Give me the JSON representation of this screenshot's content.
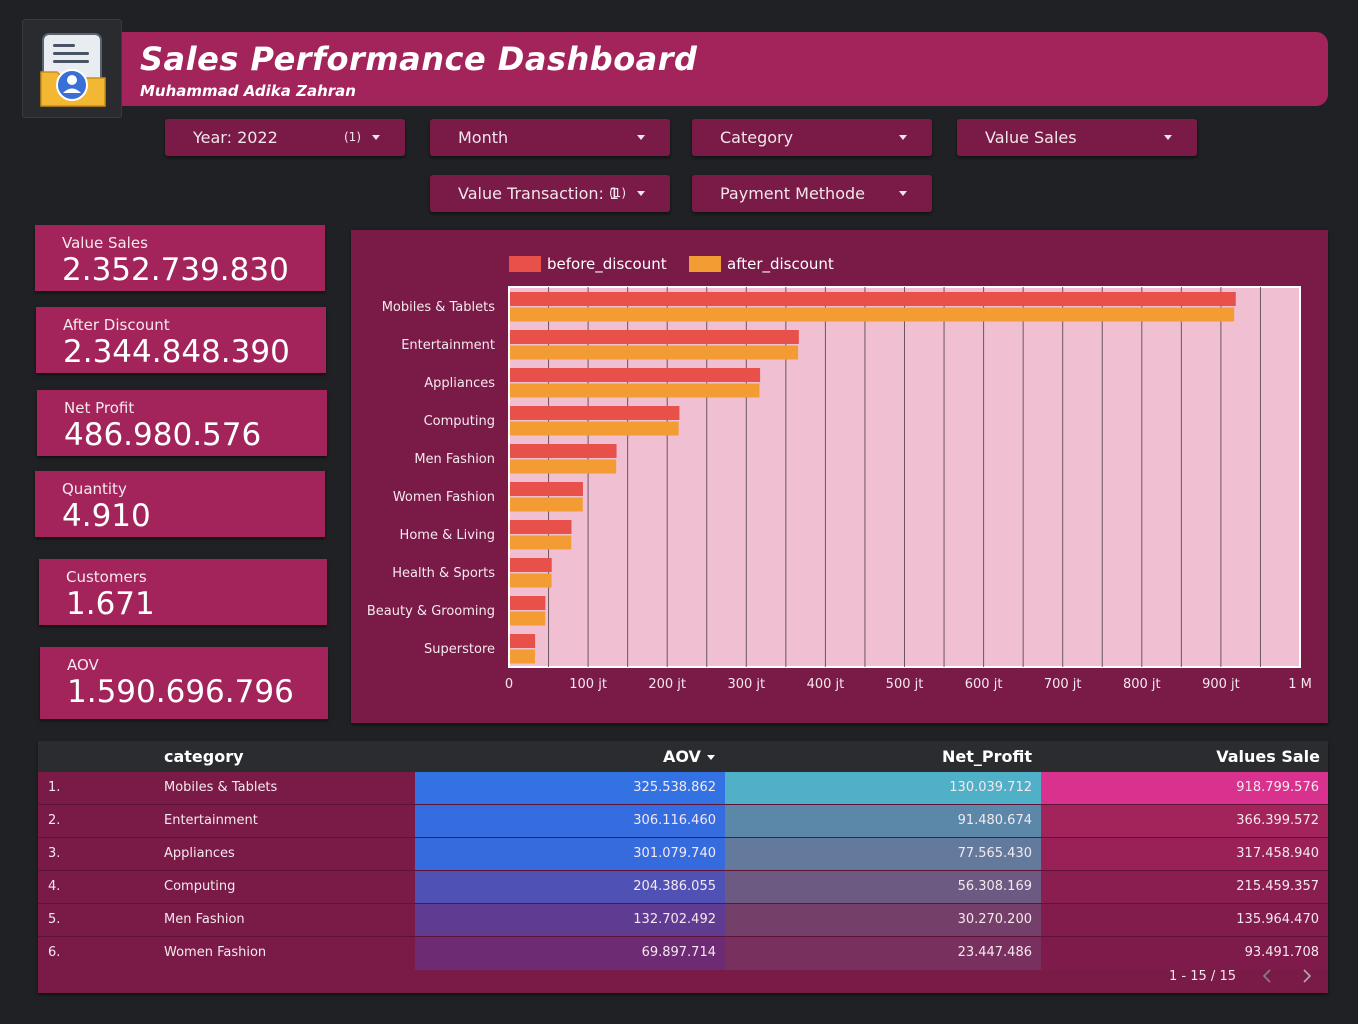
{
  "header": {
    "title": "Sales Performance Dashboard",
    "subtitle": "Muhammad Adika Zahran"
  },
  "filters": {
    "year": {
      "label": "Year: 2022",
      "count": "(1)"
    },
    "month": {
      "label": "Month"
    },
    "category": {
      "label": "Category"
    },
    "value_sales": {
      "label": "Value Sales"
    },
    "value_transaction": {
      "label": "Value Transaction: 1",
      "count": "(1)"
    },
    "payment": {
      "label": "Payment Methode"
    }
  },
  "kpis": [
    {
      "label": "Value Sales",
      "value": "2.352.739.830"
    },
    {
      "label": "After Discount",
      "value": "2.344.848.390"
    },
    {
      "label": "Net Profit",
      "value": "486.980.576"
    },
    {
      "label": "Quantity",
      "value": "4.910"
    },
    {
      "label": "Customers",
      "value": "1.671"
    },
    {
      "label": "AOV",
      "value": "1.590.696.796"
    }
  ],
  "colors": {
    "before_discount": "#e8504a",
    "after_discount": "#f39c33",
    "plot_bg": "#f0c0d2",
    "panel": "#7a1b47",
    "kpi": "#a3245a"
  },
  "chart_data": {
    "type": "bar",
    "orientation": "horizontal",
    "categories": [
      "Mobiles & Tablets",
      "Entertainment",
      "Appliances",
      "Computing",
      "Men Fashion",
      "Women Fashion",
      "Home & Living",
      "Health & Sports",
      "Beauty & Grooming",
      "Superstore"
    ],
    "series": [
      {
        "name": "before_discount",
        "values": [
          918799576,
          366399572,
          317458940,
          215459357,
          135964470,
          93491708,
          79000000,
          54000000,
          46000000,
          33000000
        ]
      },
      {
        "name": "after_discount",
        "values": [
          916800000,
          365500000,
          316700000,
          214500000,
          135500000,
          93200000,
          78700000,
          53800000,
          45800000,
          32800000
        ]
      }
    ],
    "xlim": [
      0,
      1000000000
    ],
    "xticks": [
      "0",
      "100 jt",
      "200 jt",
      "300 jt",
      "400 jt",
      "500 jt",
      "600 jt",
      "700 jt",
      "800 jt",
      "900 jt",
      "1 M"
    ],
    "legend": "top",
    "grid": true
  },
  "table": {
    "headers": {
      "category": "category",
      "aov": "AOV",
      "net_profit": "Net_Profit",
      "values_sale": "Values Sale"
    },
    "rows": [
      {
        "num": "1.",
        "category": "Mobiles & Tablets",
        "aov": "325.538.862",
        "net_profit": "130.039.712",
        "values_sale": "918.799.576",
        "aov_color": "#3272e3",
        "np_color": "#4fb0c8",
        "vs_color": "#d9318e"
      },
      {
        "num": "2.",
        "category": "Entertainment",
        "aov": "306.116.460",
        "net_profit": "91.480.674",
        "values_sale": "366.399.572",
        "aov_color": "#356de0",
        "np_color": "#5b88a8",
        "vs_color": "#a3245a"
      },
      {
        "num": "3.",
        "category": "Appliances",
        "aov": "301.079.740",
        "net_profit": "77.565.430",
        "values_sale": "317.458.940",
        "aov_color": "#366bdd",
        "np_color": "#647a9c",
        "vs_color": "#9a2157"
      },
      {
        "num": "4.",
        "category": "Computing",
        "aov": "204.386.055",
        "net_profit": "56.308.169",
        "values_sale": "215.459.357",
        "aov_color": "#5051b5",
        "np_color": "#6d5a82",
        "vs_color": "#8a1e50"
      },
      {
        "num": "5.",
        "category": "Men Fashion",
        "aov": "132.702.492",
        "net_profit": "30.270.200",
        "values_sale": "135.964.470",
        "aov_color": "#5f3c92",
        "np_color": "#743f68",
        "vs_color": "#821c4c"
      },
      {
        "num": "6.",
        "category": "Women Fashion",
        "aov": "69.897.714",
        "net_profit": "23.447.486",
        "values_sale": "93.491.708",
        "aov_color": "#6c2b72",
        "np_color": "#78315f",
        "vs_color": "#7e1b4a"
      }
    ],
    "pagination": "1 - 15 / 15"
  }
}
